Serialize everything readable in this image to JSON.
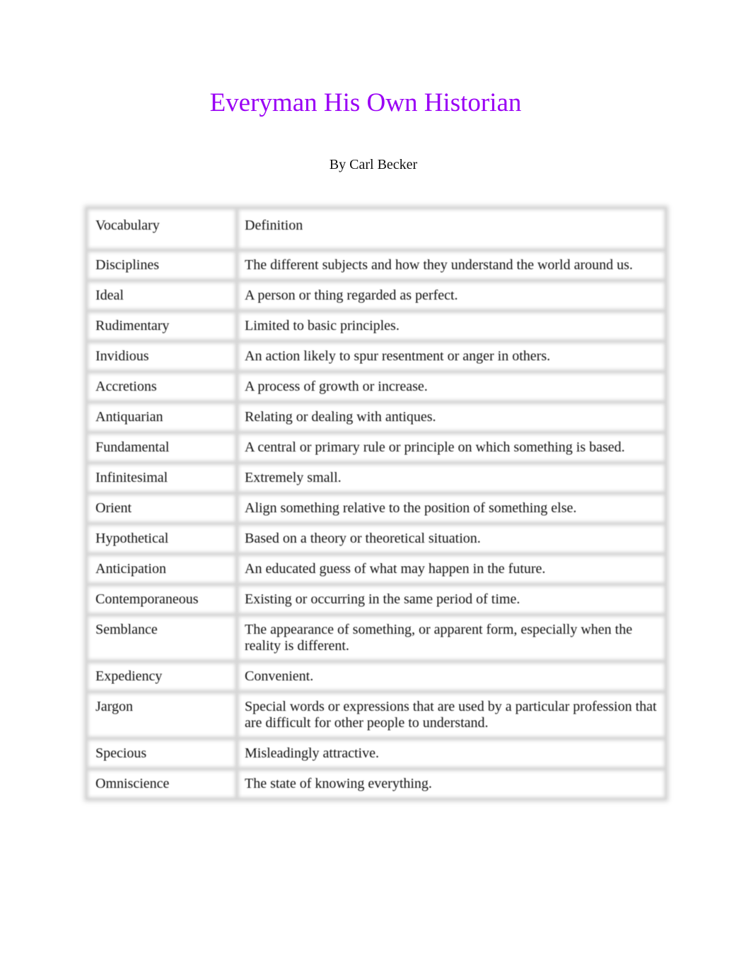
{
  "document": {
    "title": "Everyman His Own Historian",
    "title_color": "#9a00f5",
    "author": "By Carl Becker"
  },
  "table": {
    "headers": [
      "Vocabulary",
      "Definition"
    ],
    "rows": [
      {
        "term": "Disciplines",
        "definition": "The different subjects and how they understand the world around us."
      },
      {
        "term": "Ideal",
        "definition": "A person or thing regarded as perfect."
      },
      {
        "term": "Rudimentary",
        "definition": "Limited to basic principles."
      },
      {
        "term": "Invidious",
        "definition": "An action likely to spur resentment or anger in others."
      },
      {
        "term": "Accretions",
        "definition": "A process of growth or increase."
      },
      {
        "term": "Antiquarian",
        "definition": "Relating or dealing with antiques."
      },
      {
        "term": "Fundamental",
        "definition": "A central or primary rule or principle on which something is based."
      },
      {
        "term": "Infinitesimal",
        "definition": "Extremely small."
      },
      {
        "term": "Orient",
        "definition": "Align something relative to the position of something else."
      },
      {
        "term": "Hypothetical",
        "definition": "Based on a theory or theoretical situation."
      },
      {
        "term": "Anticipation",
        "definition": "An educated guess of what may happen in the future."
      },
      {
        "term": "Contemporaneous",
        "definition": "Existing or occurring in the same period of time."
      },
      {
        "term": "Semblance",
        "definition": "The appearance of something, or apparent form, especially when the reality is different."
      },
      {
        "term": "Expediency",
        "definition": "Convenient."
      },
      {
        "term": "Jargon",
        "definition": "Special words or expressions that are used by a particular profession that are difficult for other people to understand."
      },
      {
        "term": "Specious",
        "definition": "Misleadingly attractive."
      },
      {
        "term": "Omniscience",
        "definition": "The state of knowing everything."
      }
    ]
  }
}
